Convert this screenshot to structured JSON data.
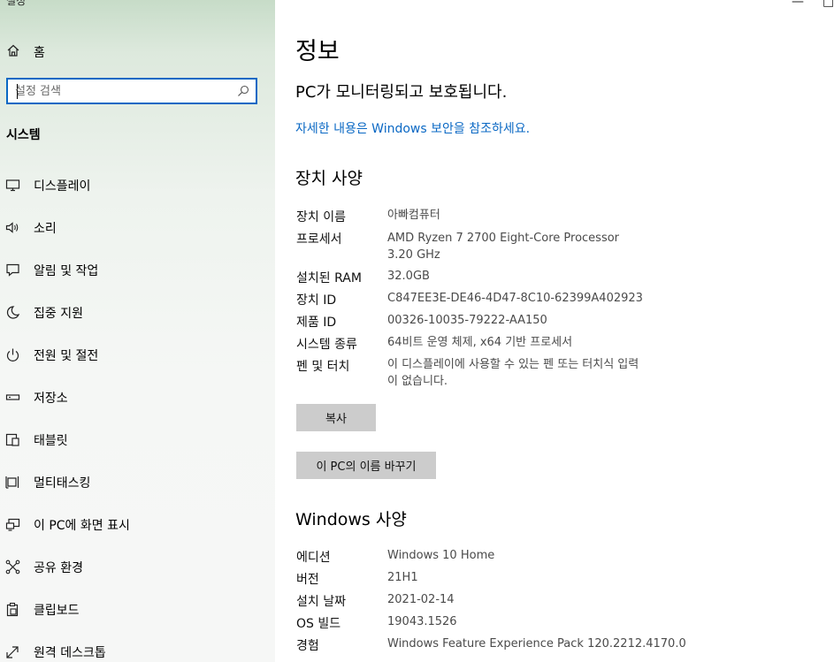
{
  "window": {
    "app_title": "설정",
    "minimize_label": "—",
    "maximize_label": "□"
  },
  "sidebar": {
    "home_label": "홈",
    "search": {
      "placeholder": "설정 검색",
      "value": ""
    },
    "section_title": "시스템",
    "items": [
      {
        "label": "디스플레이",
        "icon": "monitor-icon"
      },
      {
        "label": "소리",
        "icon": "speaker-icon"
      },
      {
        "label": "알림 및 작업",
        "icon": "notification-icon"
      },
      {
        "label": "집중 지원",
        "icon": "moon-icon"
      },
      {
        "label": "전원 및 절전",
        "icon": "power-icon"
      },
      {
        "label": "저장소",
        "icon": "storage-icon"
      },
      {
        "label": "태블릿",
        "icon": "tablet-icon"
      },
      {
        "label": "멀티태스킹",
        "icon": "multitasking-icon"
      },
      {
        "label": "이 PC에 화면 표시",
        "icon": "project-icon"
      },
      {
        "label": "공유 환경",
        "icon": "shared-experience-icon"
      },
      {
        "label": "클립보드",
        "icon": "clipboard-icon"
      },
      {
        "label": "원격 데스크톱",
        "icon": "remote-desktop-icon"
      }
    ]
  },
  "main": {
    "title": "정보",
    "protection_status": "PC가 모니터링되고 보호됩니다.",
    "security_link": "자세한 내용은 Windows 보안을 참조하세요.",
    "device_specs": {
      "heading": "장치 사양",
      "rows": [
        {
          "label": "장치 이름",
          "value": "아빠컴퓨터"
        },
        {
          "label": "프로세서",
          "value": "AMD Ryzen 7 2700 Eight-Core Processor",
          "value2": "3.20 GHz"
        },
        {
          "label": "설치된 RAM",
          "value": "32.0GB"
        },
        {
          "label": "장치 ID",
          "value": "C847EE3E-DE46-4D47-8C10-62399A402923"
        },
        {
          "label": "제품 ID",
          "value": "00326-10035-79222-AA150"
        },
        {
          "label": "시스템 종류",
          "value": "64비트 운영 체제, x64 기반 프로세서"
        },
        {
          "label": "펜 및 터치",
          "value": "이 디스플레이에 사용할 수 있는 펜 또는 터치식 입력",
          "value2": "이 없습니다."
        }
      ],
      "copy_button": "복사",
      "rename_button": "이 PC의 이름 바꾸기"
    },
    "windows_specs": {
      "heading": "Windows 사양",
      "rows": [
        {
          "label": "에디션",
          "value": "Windows 10 Home"
        },
        {
          "label": "버전",
          "value": "21H1"
        },
        {
          "label": "설치 날짜",
          "value": "2021-02-14"
        },
        {
          "label": "OS 빌드",
          "value": "19043.1526"
        },
        {
          "label": "경험",
          "value": "Windows Feature Experience Pack 120.2212.4170.0"
        }
      ]
    }
  },
  "colors": {
    "accent": "#0a68c4",
    "button_bg": "#cccccc",
    "value_text": "#4a4a4a"
  }
}
